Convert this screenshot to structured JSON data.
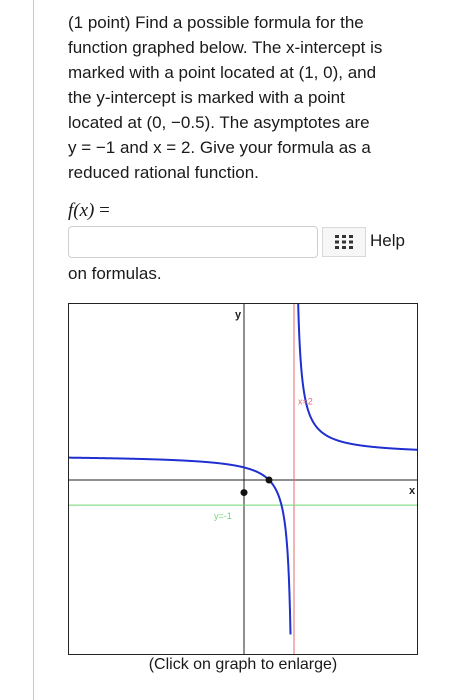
{
  "problem": {
    "lines": [
      "(1 point) Find a possible formula for the",
      "function graphed below. The x-intercept is",
      "marked with a point located at (1, 0), and",
      "the y-intercept is marked with a point",
      "located at (0, −0.5). The asymptotes are",
      "y = −1 and x = 2. Give your formula as a",
      "reduced rational function."
    ]
  },
  "answer": {
    "label_fx": "f(x)",
    "label_eq": " =",
    "value": "",
    "grid_icon": "grid-icon",
    "help_link": "Help",
    "help_suffix": "on formulas."
  },
  "graph": {
    "axis_x_label": "x",
    "axis_y_label": "y",
    "asymptote_vertical_label": "x=2",
    "asymptote_horizontal_label": "y=-1",
    "caption": "(Click on graph to enlarge)",
    "colors": {
      "curve": "#1f2fd0",
      "vertical_asymptote": "#e36b6b",
      "horizontal_asymptote": "#6fd86f",
      "axes": "#222222",
      "points": "#111111"
    }
  },
  "chart_data": {
    "type": "line",
    "function": "(x-1)/(x-2)",
    "xlim": [
      -7,
      7
    ],
    "ylim": [
      -7,
      7
    ],
    "asymptotes": {
      "vertical": 2,
      "horizontal": -1
    },
    "points": [
      {
        "label": "x-intercept",
        "x": 1,
        "y": 0
      },
      {
        "label": "y-intercept",
        "x": 0,
        "y": -0.5
      }
    ]
  }
}
